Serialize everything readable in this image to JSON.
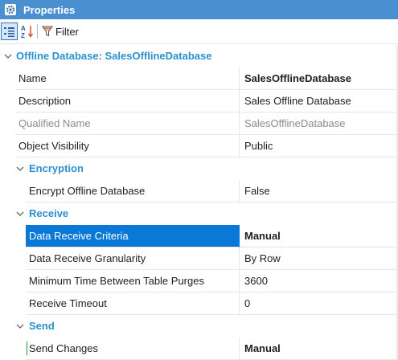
{
  "titlebar": {
    "title": "Properties",
    "icon": "gear-icon"
  },
  "toolbar": {
    "categorized_icon": "categorized-view-icon",
    "alphabetical_icon": "sort-az-icon",
    "filter_icon": "filter-funnel-icon",
    "filter_label": "Filter"
  },
  "colors": {
    "title_bg": "#4a90d0",
    "category_text": "#2b8fd1",
    "selection_bg": "#0a78d7"
  },
  "grid": {
    "root_category": "Offline Database: SalesOfflineDatabase",
    "properties": [
      {
        "name": "Name",
        "value": "SalesOfflineDatabase"
      },
      {
        "name": "Description",
        "value": "Sales Offline Database"
      },
      {
        "name": "Qualified Name",
        "value": "SalesOfflineDatabase"
      },
      {
        "name": "Object Visibility",
        "value": "Public"
      }
    ],
    "encryption": {
      "label": "Encryption",
      "properties": [
        {
          "name": "Encrypt Offline Database",
          "value": "False"
        }
      ]
    },
    "receive": {
      "label": "Receive",
      "properties": [
        {
          "name": "Data Receive Criteria",
          "value": "Manual"
        },
        {
          "name": "Data Receive Granularity",
          "value": "By Row"
        },
        {
          "name": "Minimum Time Between Table Purges",
          "value": "3600"
        },
        {
          "name": "Receive Timeout",
          "value": "0"
        }
      ]
    },
    "send": {
      "label": "Send",
      "properties": [
        {
          "name": "Send Changes",
          "value": "Manual"
        }
      ]
    }
  }
}
